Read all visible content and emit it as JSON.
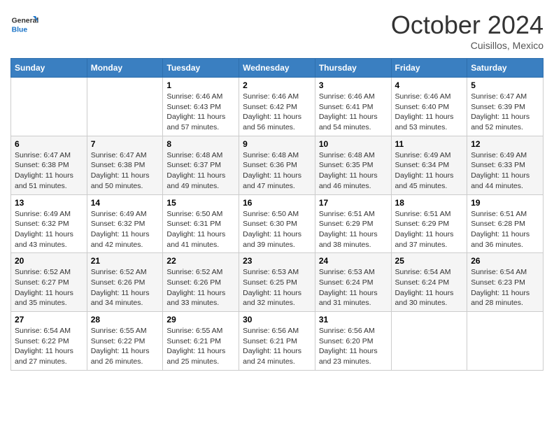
{
  "logo": {
    "general": "General",
    "blue": "Blue"
  },
  "header": {
    "month": "October 2024",
    "location": "Cuisillos, Mexico"
  },
  "weekdays": [
    "Sunday",
    "Monday",
    "Tuesday",
    "Wednesday",
    "Thursday",
    "Friday",
    "Saturday"
  ],
  "weeks": [
    [
      {
        "day": "",
        "info": ""
      },
      {
        "day": "",
        "info": ""
      },
      {
        "day": "1",
        "info": "Sunrise: 6:46 AM\nSunset: 6:43 PM\nDaylight: 11 hours and 57 minutes."
      },
      {
        "day": "2",
        "info": "Sunrise: 6:46 AM\nSunset: 6:42 PM\nDaylight: 11 hours and 56 minutes."
      },
      {
        "day": "3",
        "info": "Sunrise: 6:46 AM\nSunset: 6:41 PM\nDaylight: 11 hours and 54 minutes."
      },
      {
        "day": "4",
        "info": "Sunrise: 6:46 AM\nSunset: 6:40 PM\nDaylight: 11 hours and 53 minutes."
      },
      {
        "day": "5",
        "info": "Sunrise: 6:47 AM\nSunset: 6:39 PM\nDaylight: 11 hours and 52 minutes."
      }
    ],
    [
      {
        "day": "6",
        "info": "Sunrise: 6:47 AM\nSunset: 6:38 PM\nDaylight: 11 hours and 51 minutes."
      },
      {
        "day": "7",
        "info": "Sunrise: 6:47 AM\nSunset: 6:38 PM\nDaylight: 11 hours and 50 minutes."
      },
      {
        "day": "8",
        "info": "Sunrise: 6:48 AM\nSunset: 6:37 PM\nDaylight: 11 hours and 49 minutes."
      },
      {
        "day": "9",
        "info": "Sunrise: 6:48 AM\nSunset: 6:36 PM\nDaylight: 11 hours and 47 minutes."
      },
      {
        "day": "10",
        "info": "Sunrise: 6:48 AM\nSunset: 6:35 PM\nDaylight: 11 hours and 46 minutes."
      },
      {
        "day": "11",
        "info": "Sunrise: 6:49 AM\nSunset: 6:34 PM\nDaylight: 11 hours and 45 minutes."
      },
      {
        "day": "12",
        "info": "Sunrise: 6:49 AM\nSunset: 6:33 PM\nDaylight: 11 hours and 44 minutes."
      }
    ],
    [
      {
        "day": "13",
        "info": "Sunrise: 6:49 AM\nSunset: 6:32 PM\nDaylight: 11 hours and 43 minutes."
      },
      {
        "day": "14",
        "info": "Sunrise: 6:49 AM\nSunset: 6:32 PM\nDaylight: 11 hours and 42 minutes."
      },
      {
        "day": "15",
        "info": "Sunrise: 6:50 AM\nSunset: 6:31 PM\nDaylight: 11 hours and 41 minutes."
      },
      {
        "day": "16",
        "info": "Sunrise: 6:50 AM\nSunset: 6:30 PM\nDaylight: 11 hours and 39 minutes."
      },
      {
        "day": "17",
        "info": "Sunrise: 6:51 AM\nSunset: 6:29 PM\nDaylight: 11 hours and 38 minutes."
      },
      {
        "day": "18",
        "info": "Sunrise: 6:51 AM\nSunset: 6:29 PM\nDaylight: 11 hours and 37 minutes."
      },
      {
        "day": "19",
        "info": "Sunrise: 6:51 AM\nSunset: 6:28 PM\nDaylight: 11 hours and 36 minutes."
      }
    ],
    [
      {
        "day": "20",
        "info": "Sunrise: 6:52 AM\nSunset: 6:27 PM\nDaylight: 11 hours and 35 minutes."
      },
      {
        "day": "21",
        "info": "Sunrise: 6:52 AM\nSunset: 6:26 PM\nDaylight: 11 hours and 34 minutes."
      },
      {
        "day": "22",
        "info": "Sunrise: 6:52 AM\nSunset: 6:26 PM\nDaylight: 11 hours and 33 minutes."
      },
      {
        "day": "23",
        "info": "Sunrise: 6:53 AM\nSunset: 6:25 PM\nDaylight: 11 hours and 32 minutes."
      },
      {
        "day": "24",
        "info": "Sunrise: 6:53 AM\nSunset: 6:24 PM\nDaylight: 11 hours and 31 minutes."
      },
      {
        "day": "25",
        "info": "Sunrise: 6:54 AM\nSunset: 6:24 PM\nDaylight: 11 hours and 30 minutes."
      },
      {
        "day": "26",
        "info": "Sunrise: 6:54 AM\nSunset: 6:23 PM\nDaylight: 11 hours and 28 minutes."
      }
    ],
    [
      {
        "day": "27",
        "info": "Sunrise: 6:54 AM\nSunset: 6:22 PM\nDaylight: 11 hours and 27 minutes."
      },
      {
        "day": "28",
        "info": "Sunrise: 6:55 AM\nSunset: 6:22 PM\nDaylight: 11 hours and 26 minutes."
      },
      {
        "day": "29",
        "info": "Sunrise: 6:55 AM\nSunset: 6:21 PM\nDaylight: 11 hours and 25 minutes."
      },
      {
        "day": "30",
        "info": "Sunrise: 6:56 AM\nSunset: 6:21 PM\nDaylight: 11 hours and 24 minutes."
      },
      {
        "day": "31",
        "info": "Sunrise: 6:56 AM\nSunset: 6:20 PM\nDaylight: 11 hours and 23 minutes."
      },
      {
        "day": "",
        "info": ""
      },
      {
        "day": "",
        "info": ""
      }
    ]
  ]
}
